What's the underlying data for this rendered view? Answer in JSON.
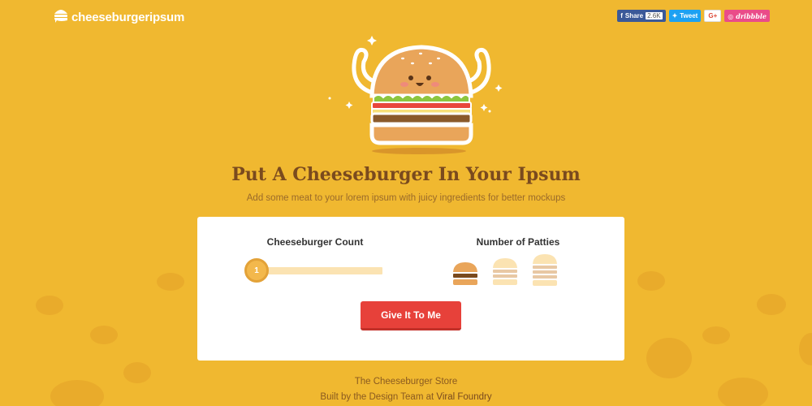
{
  "header": {
    "logo_text": "cheeseburgeripsum",
    "share": {
      "facebook_label": "Share",
      "facebook_count": "2.6K",
      "twitter_label": "Tweet",
      "gplus_label": "G+",
      "dribbble_label": "dribbble"
    }
  },
  "hero": {
    "title": "Put A Cheeseburger In Your Ipsum",
    "subtitle": "Add some meat to your lorem ipsum with juicy ingredients for better mockups"
  },
  "form": {
    "count_label": "Cheeseburger Count",
    "count_value": "1",
    "patties_label": "Number of Patties",
    "patty_options": [
      {
        "patties": 1,
        "selected": true
      },
      {
        "patties": 2,
        "selected": false
      },
      {
        "patties": 3,
        "selected": false
      }
    ],
    "submit_label": "Give It To Me"
  },
  "footer": {
    "line1": "The Cheeseburger Store",
    "line2_prefix": "Built by the Design Team at",
    "line2_link": "Viral Foundry"
  },
  "colors": {
    "background": "#f0b830",
    "title": "#7a4a1e",
    "button": "#e7413a",
    "card": "#ffffff"
  }
}
